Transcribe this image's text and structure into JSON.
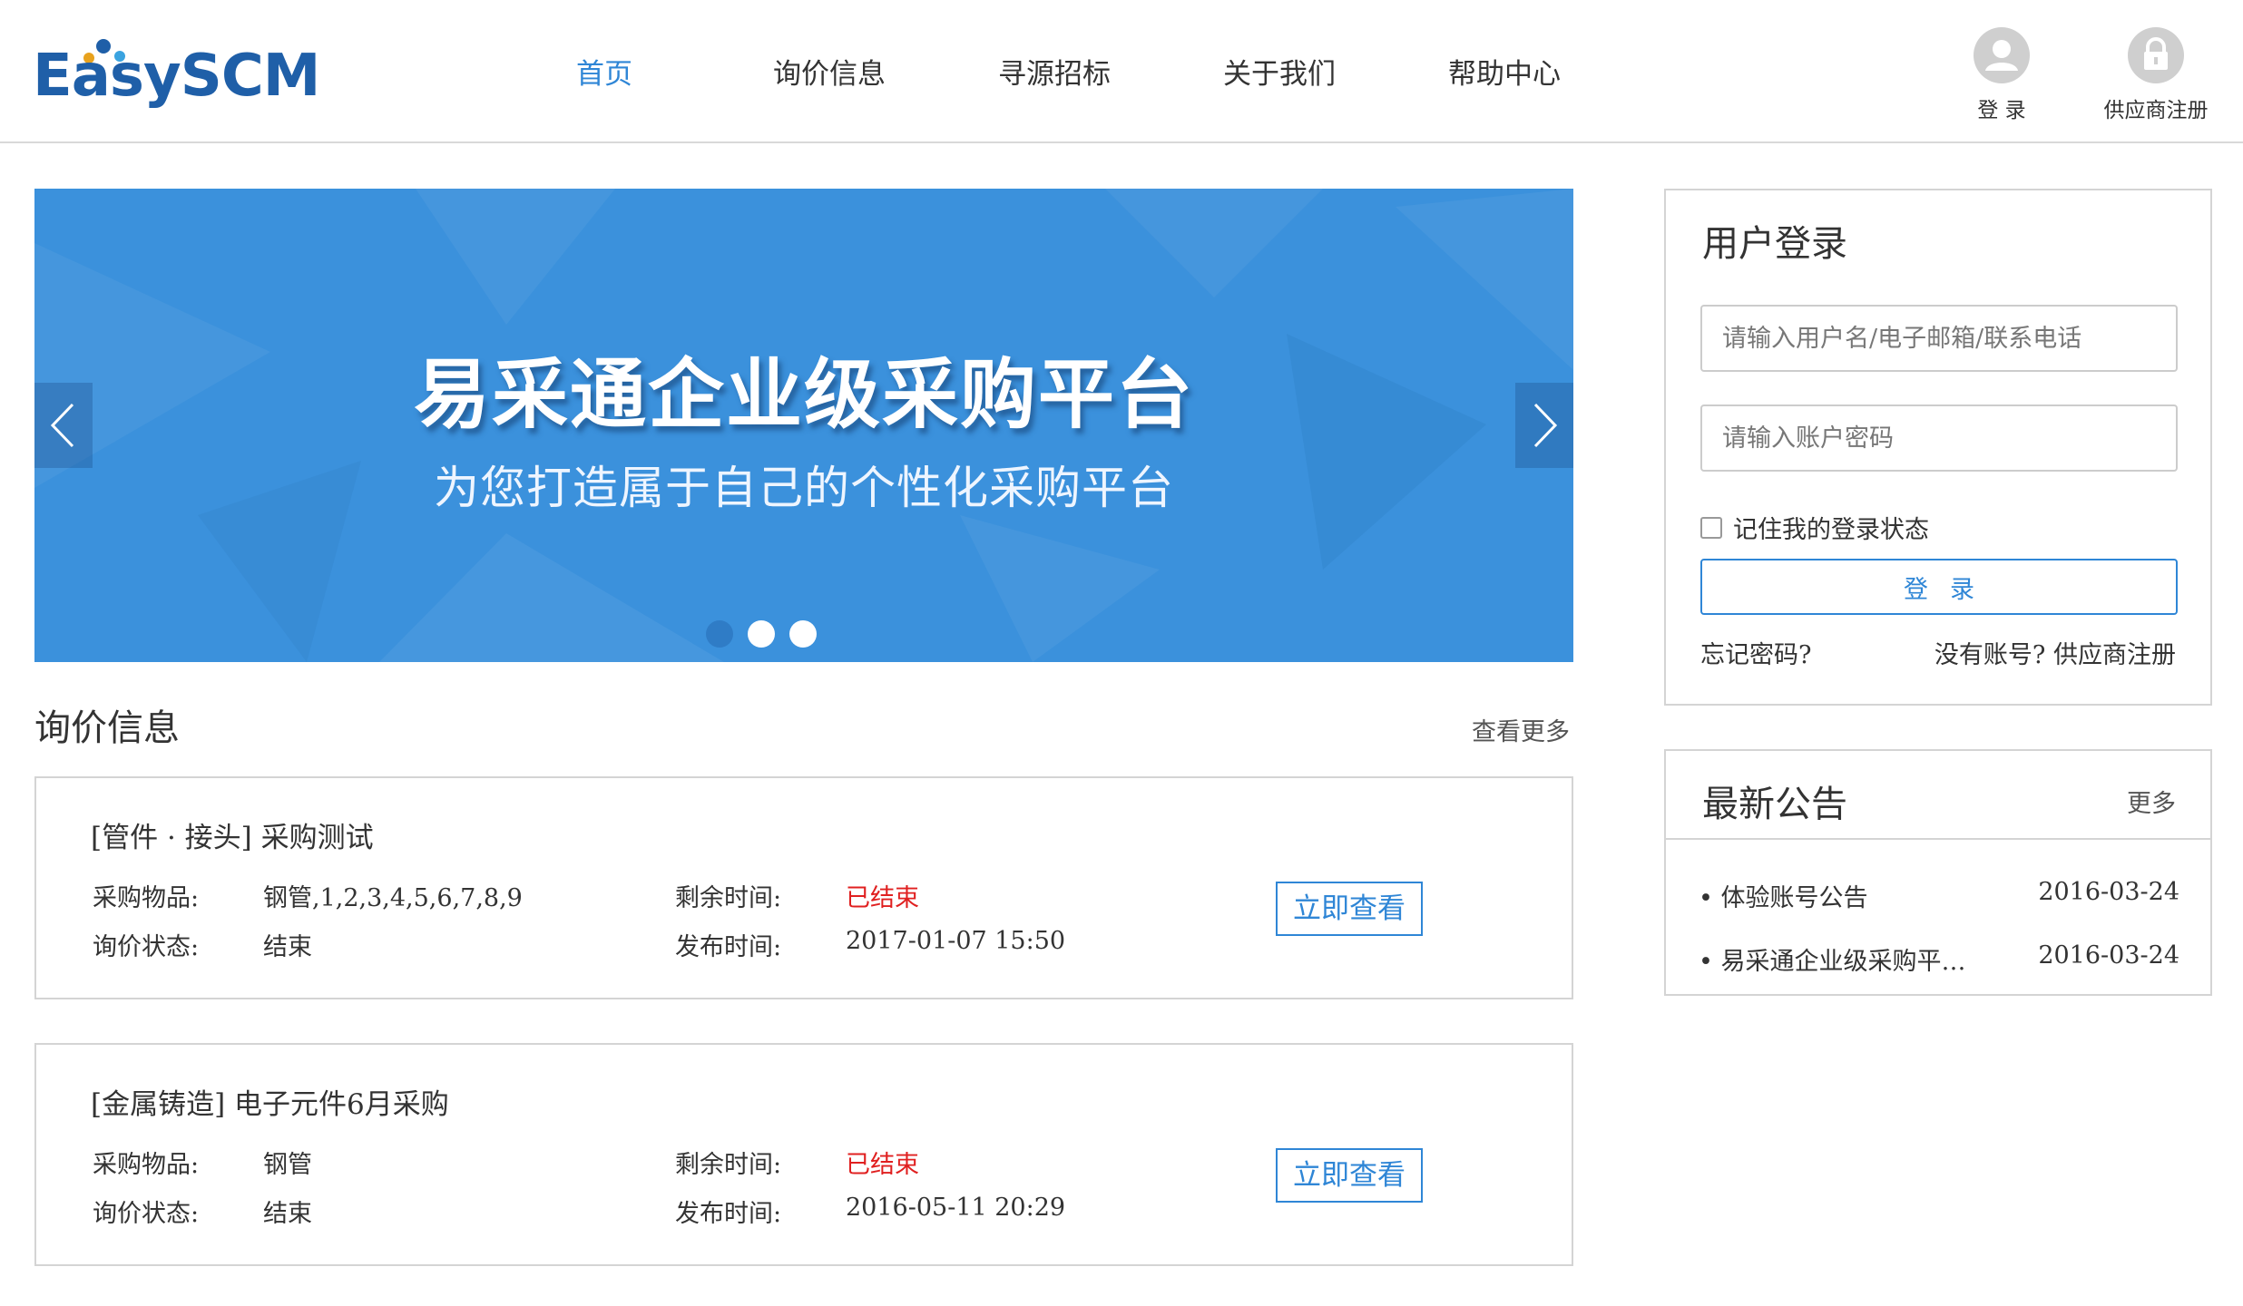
{
  "header": {
    "logo_text": "EasySCM",
    "nav": [
      "首页",
      "询价信息",
      "寻源招标",
      "关于我们",
      "帮助中心"
    ],
    "active_nav": 0,
    "login_label": "登 录",
    "register_label": "供应商注册"
  },
  "banner": {
    "title": "易采通企业级采购平台",
    "subtitle": "为您打造属于自己的个性化采购平台",
    "slide_count": 3,
    "active_slide": 0,
    "background_color": "#3b91dc"
  },
  "inquiry": {
    "title": "询价信息",
    "more": "查看更多",
    "items": [
      {
        "title": "[管件 · 接头] 采购测试",
        "goods_label": "采购物品:",
        "goods": "钢管,1,2,3,4,5,6,7,8,9",
        "remaining_label": "剩余时间:",
        "remaining": "已结束",
        "status_label": "询价状态:",
        "status": "结束",
        "publish_label": "发布时间:",
        "publish": "2017-01-07 15:50",
        "button": "立即查看"
      },
      {
        "title": "[金属铸造] 电子元件6月采购",
        "goods_label": "采购物品:",
        "goods": "钢管",
        "remaining_label": "剩余时间:",
        "remaining": "已结束",
        "status_label": "询价状态:",
        "status": "结束",
        "publish_label": "发布时间:",
        "publish": "2016-05-11 20:29",
        "button": "立即查看"
      }
    ]
  },
  "login": {
    "title": "用户登录",
    "username_placeholder": "请输入用户名/电子邮箱/联系电话",
    "password_placeholder": "请输入账户密码",
    "remember": "记住我的登录状态",
    "remember_checked": false,
    "button": "登录",
    "forgot": "忘记密码?",
    "no_account": "没有账号?",
    "register": "供应商注册"
  },
  "notice": {
    "title": "最新公告",
    "more": "更多",
    "items": [
      {
        "title": "• 体验账号公告",
        "date": "2016-03-24"
      },
      {
        "title": "• 易采通企业级采购平…",
        "date": "2016-03-24"
      }
    ]
  },
  "colors": {
    "accent": "#2f86d6",
    "expired_red": "#e02020",
    "logo_blue": "#1f5fa8"
  },
  "icons": {
    "login": "user-icon",
    "register": "lock-icon",
    "banner_prev": "chevron-left-icon",
    "banner_next": "chevron-right-icon"
  }
}
